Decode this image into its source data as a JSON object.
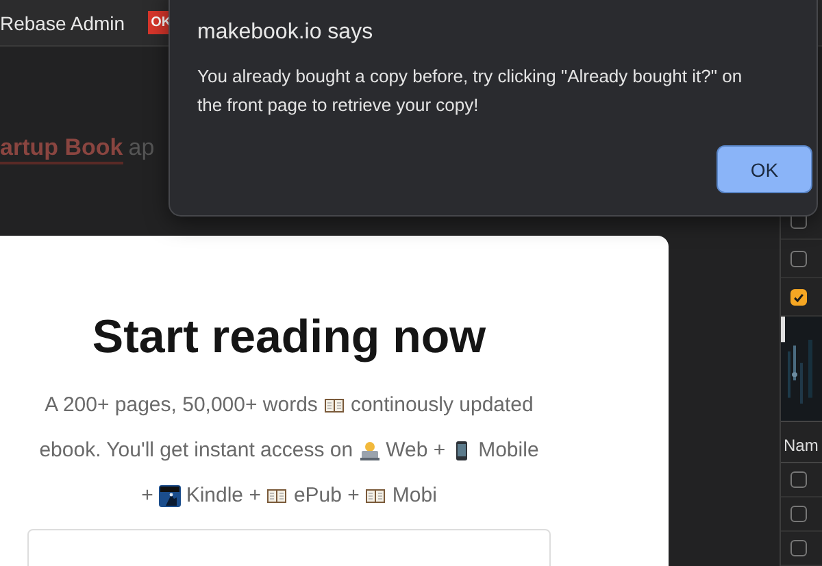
{
  "top_bar": {
    "title": "Rebase Admin",
    "badge": "OK"
  },
  "background_headline": {
    "link": "artup Book",
    "text": "ap"
  },
  "card": {
    "title": "Start reading now",
    "lines": [
      [
        {
          "kind": "text",
          "text": "A 200+ pages, 50,000+ words"
        },
        {
          "kind": "book"
        },
        {
          "kind": "text",
          "text": "continously updated"
        }
      ],
      [
        {
          "kind": "text",
          "text": "ebook. You'll get instant access on"
        },
        {
          "kind": "laptop"
        },
        {
          "kind": "text",
          "text": "Web +"
        },
        {
          "kind": "phone"
        },
        {
          "kind": "text",
          "text": "Mobile"
        }
      ],
      [
        {
          "kind": "text",
          "text": "+"
        },
        {
          "kind": "kindle"
        },
        {
          "kind": "text",
          "text": "Kindle +"
        },
        {
          "kind": "book"
        },
        {
          "kind": "text",
          "text": "ePub +"
        },
        {
          "kind": "book"
        },
        {
          "kind": "text",
          "text": "Mobi"
        }
      ]
    ]
  },
  "side_panel": {
    "checkboxes": [
      {
        "checked": false
      },
      {
        "checked": false
      },
      {
        "checked": true
      }
    ],
    "header": "Nam",
    "rows": [
      {
        "checked": false
      },
      {
        "checked": false
      },
      {
        "checked": false
      }
    ]
  },
  "dialog": {
    "title": "makebook.io says",
    "message": "You already bought a copy before, try clicking \"Already bought it?\" on the front page to retrieve your copy!",
    "button": "OK"
  }
}
